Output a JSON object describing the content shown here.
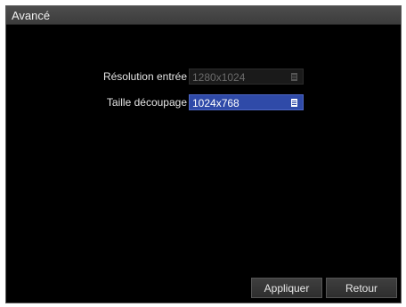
{
  "window": {
    "title": "Avancé"
  },
  "form": {
    "input_resolution": {
      "label": "Résolution entrée",
      "value": "1280x1024",
      "enabled": false
    },
    "crop_size": {
      "label": "Taille découpage",
      "value": "1024x768",
      "enabled": true
    }
  },
  "buttons": {
    "apply_label": "Appliquer",
    "back_label": "Retour"
  },
  "icons": {
    "dropdown": "dropdown-list-icon"
  },
  "colors": {
    "background": "#000000",
    "titlebar": "#444444",
    "selected_field": "#2f4aa8",
    "text": "#e6e6e6",
    "disabled_text": "#6b6b6b"
  }
}
